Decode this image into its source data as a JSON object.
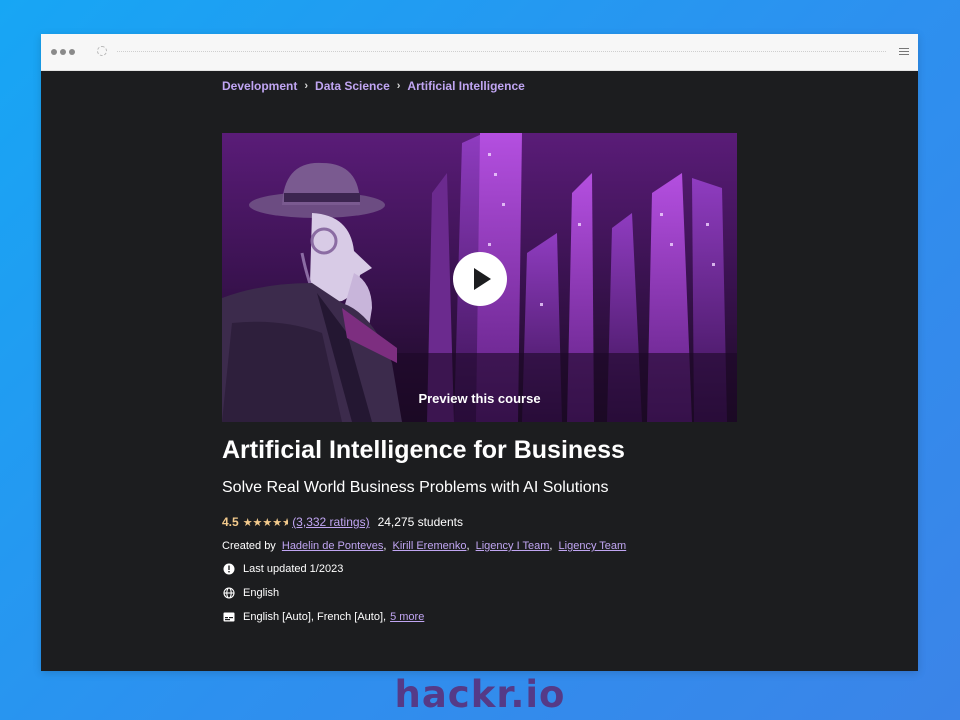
{
  "breadcrumb": [
    "Development",
    "Data Science",
    "Artificial Intelligence"
  ],
  "preview": {
    "label": "Preview this course"
  },
  "course": {
    "title": "Artificial Intelligence for Business",
    "subtitle": "Solve Real World Business Problems with AI Solutions",
    "rating": "4.5",
    "stars": 4.5,
    "ratings_count": "(3,332 ratings)",
    "students": "24,275 students",
    "created_by_label": "Created by",
    "instructors": [
      "Hadelin de Ponteves",
      "Kirill Eremenko",
      "Ligency I Team",
      "Ligency Team"
    ],
    "last_updated": "Last updated 1/2023",
    "language": "English",
    "captions": "English [Auto], French [Auto],",
    "captions_more": "5 more"
  },
  "brand": "hackr.io",
  "colors": {
    "page_bg": "#1c1d1f",
    "link": "#c0a5f2",
    "star": "#f3ca8c",
    "outer_bg": "#2d90ef",
    "brand": "#553a87"
  },
  "icons": [
    "play-icon",
    "star-icon",
    "alert-icon",
    "globe-icon",
    "captions-icon",
    "menu-icon",
    "reload-icon"
  ]
}
